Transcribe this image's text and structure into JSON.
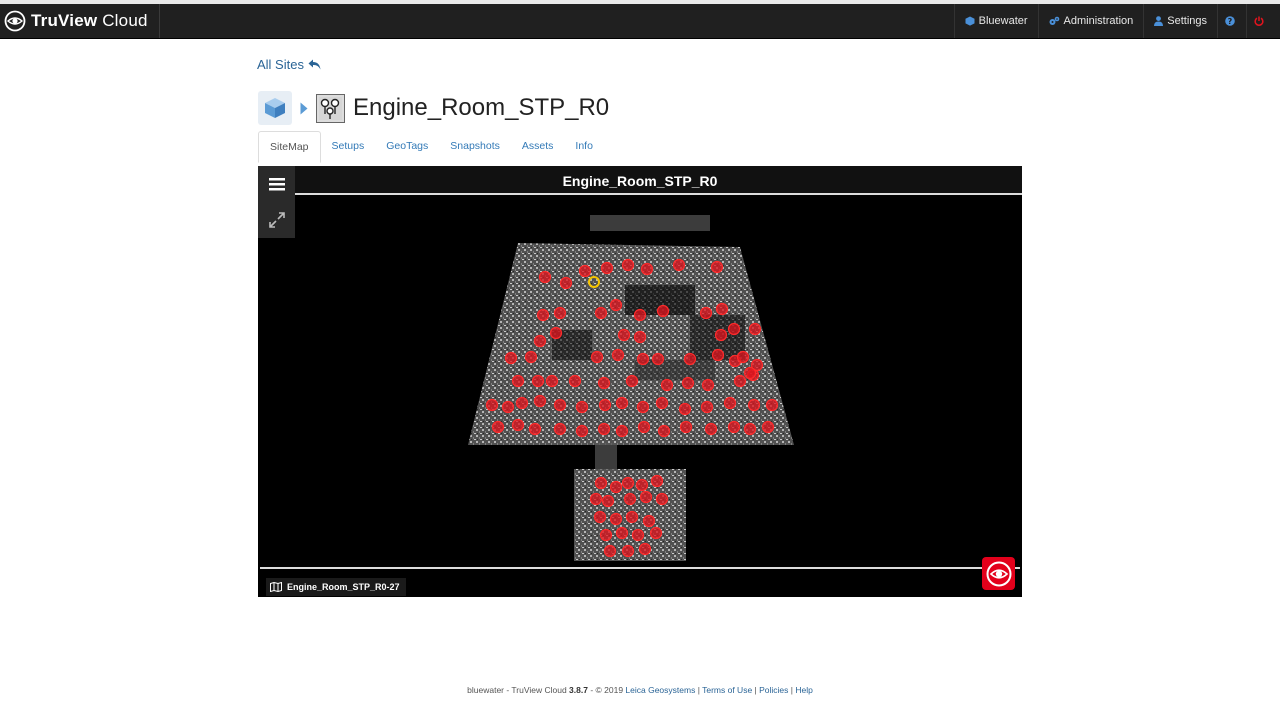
{
  "navbar": {
    "brand_bold": "TruView",
    "brand_rest": " Cloud",
    "items": [
      {
        "label": "Bluewater",
        "icon": "cube-icon"
      },
      {
        "label": "Administration",
        "icon": "gears-icon"
      },
      {
        "label": "Settings",
        "icon": "user-icon"
      }
    ],
    "help_icon": "help-icon",
    "power_icon": "power-icon"
  },
  "breadcrumb": {
    "back_label": "All Sites"
  },
  "page": {
    "title": "Engine_Room_STP_R0"
  },
  "tabs": [
    {
      "label": "SiteMap",
      "active": true
    },
    {
      "label": "Setups"
    },
    {
      "label": "GeoTags"
    },
    {
      "label": "Snapshots"
    },
    {
      "label": "Assets"
    },
    {
      "label": "Info"
    }
  ],
  "viewer": {
    "title": "Engine_Room_STP_R0",
    "footer_label": "Engine_Room_STP_R0-27"
  },
  "footer": {
    "prefix": "bluewater - TruView Cloud ",
    "version": "3.8.7",
    "copyright": " - © 2019 ",
    "company": "Leica Geosystems",
    "sep": " | ",
    "terms": "Terms of Use",
    "policies": "Policies",
    "help": "Help"
  },
  "colors": {
    "navbar": "#202020",
    "link": "#2a6496",
    "marker": "#e0141e",
    "selected_marker": "#f5c400",
    "leica_red": "#e3001b"
  }
}
